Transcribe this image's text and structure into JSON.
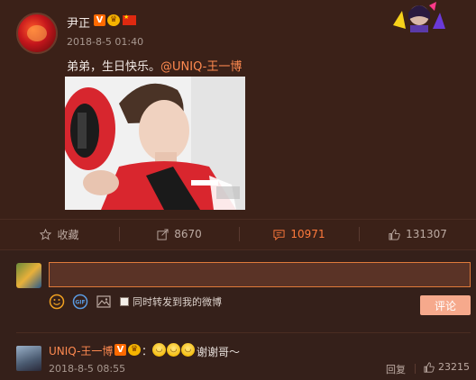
{
  "post": {
    "author": "尹正",
    "badge_v": "V",
    "timestamp": "2018-8-5 01:40",
    "text_prefix": "弟弟，生日快乐。",
    "mention": "@UNIQ-王一博"
  },
  "actions": [
    {
      "icon": "star-icon",
      "label": "收藏"
    },
    {
      "icon": "share-icon",
      "label": "8670"
    },
    {
      "icon": "comment-icon",
      "label": "10971"
    },
    {
      "icon": "thumbs-up-icon",
      "label": "131307"
    }
  ],
  "composer": {
    "input_value": "",
    "repost_label": "同时转发到我的微博",
    "submit_label": "评论"
  },
  "comment": {
    "author": "UNIQ-王一博",
    "badge_v": "V",
    "colon": "：",
    "text": "谢谢哥～",
    "timestamp": "2018-8-5 08:55",
    "reply_label": "回复",
    "likes": "23215"
  },
  "colors": {
    "background": "#3b2118",
    "accent": "#ff7a3c",
    "input_border": "#e07a3a",
    "submit_button": "#f6a98c"
  }
}
